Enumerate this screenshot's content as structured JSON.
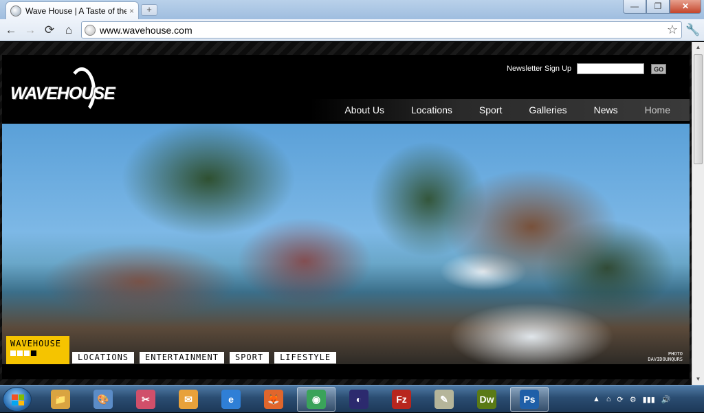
{
  "browser": {
    "tab_title": "Wave House | A Taste of the",
    "tab_close": "×",
    "new_tab": "+",
    "url": "www.wavehouse.com",
    "window_buttons": [
      "—",
      "❐",
      "✕"
    ]
  },
  "site": {
    "logo_text": "WAVEHOUSE",
    "newsletter_label": "Newsletter Sign Up",
    "newsletter_go": "GO",
    "nav": [
      "About Us",
      "Locations",
      "Sport",
      "Galleries",
      "News",
      "Home"
    ],
    "brand_tag": "WAVEHOUSE",
    "subnav": [
      "LOCATIONS",
      "ENTERTAINMENT",
      "SPORT",
      "LIFESTYLE"
    ],
    "photo_credit_label": "PHOTO",
    "photo_credit_name": "DAVIDOUNQURS"
  },
  "taskbar": {
    "apps": [
      {
        "name": "Windows Explorer",
        "label": "📁",
        "color": "#d9a441"
      },
      {
        "name": "Paint",
        "label": "🎨",
        "color": "#5b8cc7"
      },
      {
        "name": "Snipping Tool",
        "label": "✂",
        "color": "#d04f6a"
      },
      {
        "name": "Outlook",
        "label": "✉",
        "color": "#e8a13a"
      },
      {
        "name": "Internet Explorer",
        "label": "e",
        "color": "#2f7fd6"
      },
      {
        "name": "Firefox",
        "label": "🦊",
        "color": "#e0662c"
      },
      {
        "name": "Chrome",
        "label": "◉",
        "color": "#3aa35a"
      },
      {
        "name": "Eclipse",
        "label": "◐",
        "color": "#2c2a6e"
      },
      {
        "name": "FileZilla",
        "label": "Fz",
        "color": "#b8261e"
      },
      {
        "name": "Notepad",
        "label": "✎",
        "color": "#b5b59a"
      },
      {
        "name": "Dreamweaver",
        "label": "Dw",
        "color": "#5a7a16"
      },
      {
        "name": "Photoshop",
        "label": "Ps",
        "color": "#1f5fa8"
      }
    ],
    "tray": [
      "▲",
      "⌂",
      "⟳",
      "⚙",
      "▮▮▮",
      "🔊"
    ]
  }
}
